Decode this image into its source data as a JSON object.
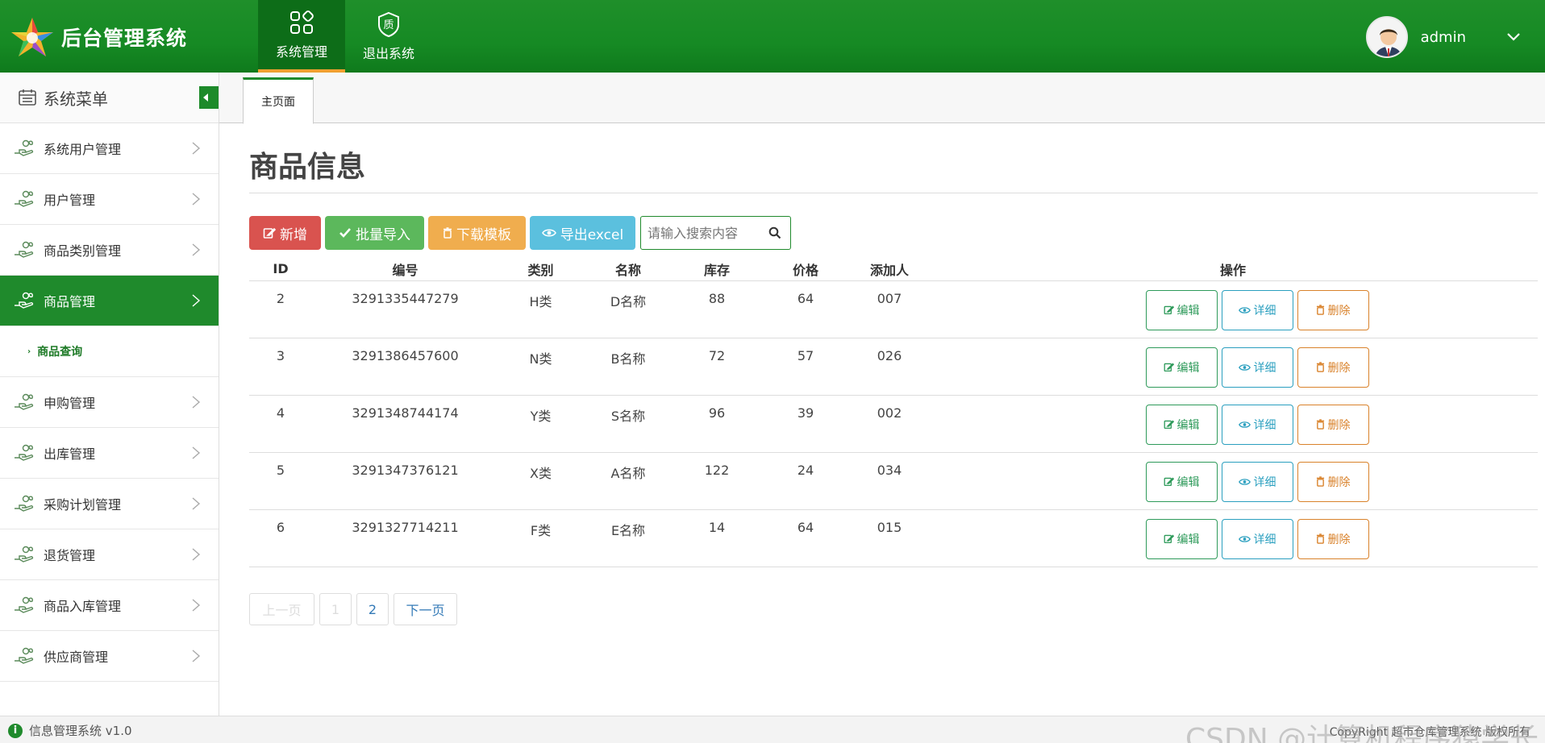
{
  "app": {
    "title": "后台管理系统"
  },
  "topnav": [
    {
      "label": "系统管理",
      "icon": "grid-icon",
      "active": true
    },
    {
      "label": "退出系统",
      "icon": "quality-icon",
      "active": false
    }
  ],
  "user": {
    "name": "admin"
  },
  "sidebar": {
    "title": "系统菜单",
    "items": [
      {
        "label": "系统用户管理"
      },
      {
        "label": "用户管理"
      },
      {
        "label": "商品类别管理"
      },
      {
        "label": "商品管理",
        "active": true
      },
      {
        "label": "申购管理"
      },
      {
        "label": "出库管理"
      },
      {
        "label": "采购计划管理"
      },
      {
        "label": "退货管理"
      },
      {
        "label": "商品入库管理"
      },
      {
        "label": "供应商管理"
      }
    ],
    "sub_item": "商品查询"
  },
  "tabs": [
    {
      "label": "主页面"
    }
  ],
  "page": {
    "title": "商品信息"
  },
  "toolbar": {
    "add": "新增",
    "import": "批量导入",
    "template": "下载模板",
    "export": "导出excel",
    "search_placeholder": "请输入搜索内容"
  },
  "table": {
    "headers": [
      "ID",
      "编号",
      "类别",
      "名称",
      "库存",
      "价格",
      "添加人",
      "操作"
    ],
    "rows": [
      [
        "2",
        "3291335447279",
        "H类",
        "D名称",
        "88",
        "64",
        "007"
      ],
      [
        "3",
        "3291386457600",
        "N类",
        "B名称",
        "72",
        "57",
        "026"
      ],
      [
        "4",
        "3291348744174",
        "Y类",
        "S名称",
        "96",
        "39",
        "002"
      ],
      [
        "5",
        "3291347376121",
        "X类",
        "A名称",
        "122",
        "24",
        "034"
      ],
      [
        "6",
        "3291327714211",
        "F类",
        "E名称",
        "14",
        "64",
        "015"
      ]
    ],
    "actions": {
      "edit": "编辑",
      "detail": "详细",
      "delete": "删除"
    }
  },
  "pager": {
    "prev": "上一页",
    "pages": [
      "1",
      "2"
    ],
    "next": "下一页"
  },
  "footer": {
    "version": "信息管理系统 v1.0",
    "copyright": "CopyRight  超市仓库管理系统 版权所有",
    "watermark": "CSDN @计算机程序猿学长"
  },
  "colors": {
    "primary": "#1f8a2c",
    "danger": "#d9534f",
    "success": "#5cb85c",
    "warning": "#f0ad4e",
    "info": "#5bc0de"
  }
}
